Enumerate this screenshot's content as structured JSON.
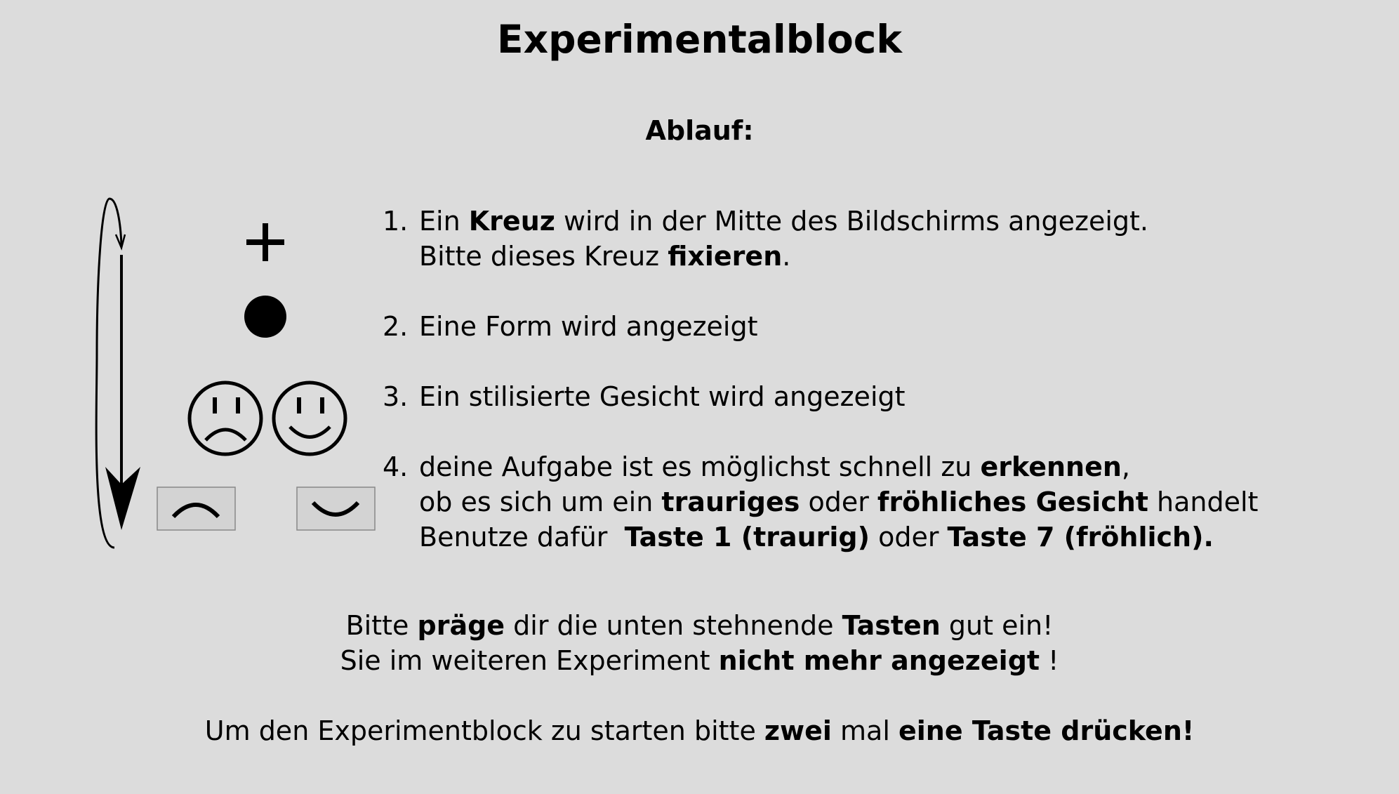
{
  "title": "Experimentalblock",
  "subtitle": "Ablauf:",
  "icons": [
    "cycle-arrow-icon",
    "fixation-cross-icon",
    "circle-shape-icon",
    "sad-face-icon",
    "happy-face-icon",
    "frown-key-icon",
    "smile-key-icon"
  ],
  "steps": [
    {
      "number": "1.",
      "line1": {
        "a": "Ein ",
        "b": "Kreuz",
        "c": " wird in der Mitte des Bildschirms angezeigt."
      },
      "line2": {
        "a": "Bitte dieses Kreuz ",
        "b": "fixieren",
        "c": "."
      }
    },
    {
      "number": "2.",
      "line1": "Eine Form wird angezeigt"
    },
    {
      "number": "3.",
      "line1": "Ein stilisierte Gesicht wird angezeigt"
    },
    {
      "number": "4.",
      "line1": {
        "a": "deine Aufgabe ist es möglichst schnell zu ",
        "b": "erkennen",
        "c": ","
      },
      "line2": {
        "a": "ob es sich um ein ",
        "b": "trauriges",
        "c": " oder ",
        "d": "fröhliches Gesicht",
        "e": " handelt"
      },
      "line3": {
        "a": "Benutze dafür  ",
        "b": "Taste 1 (traurig)",
        "c": " oder ",
        "d": "Taste 7 (fröhlich)."
      }
    }
  ],
  "notes": {
    "line1": {
      "a": "Bitte ",
      "b": "präge",
      "c": " dir die unten stehnende ",
      "d": "Tasten",
      "e": " gut ein!"
    },
    "line2": {
      "a": "Sie im weiteren Experiment ",
      "b": "nicht mehr angezeigt",
      "c": " !"
    },
    "line3": {
      "a": "Um den Experimentblock zu starten bitte ",
      "b": "zwei",
      "c": " mal ",
      "d": "eine Taste drücken!"
    }
  }
}
